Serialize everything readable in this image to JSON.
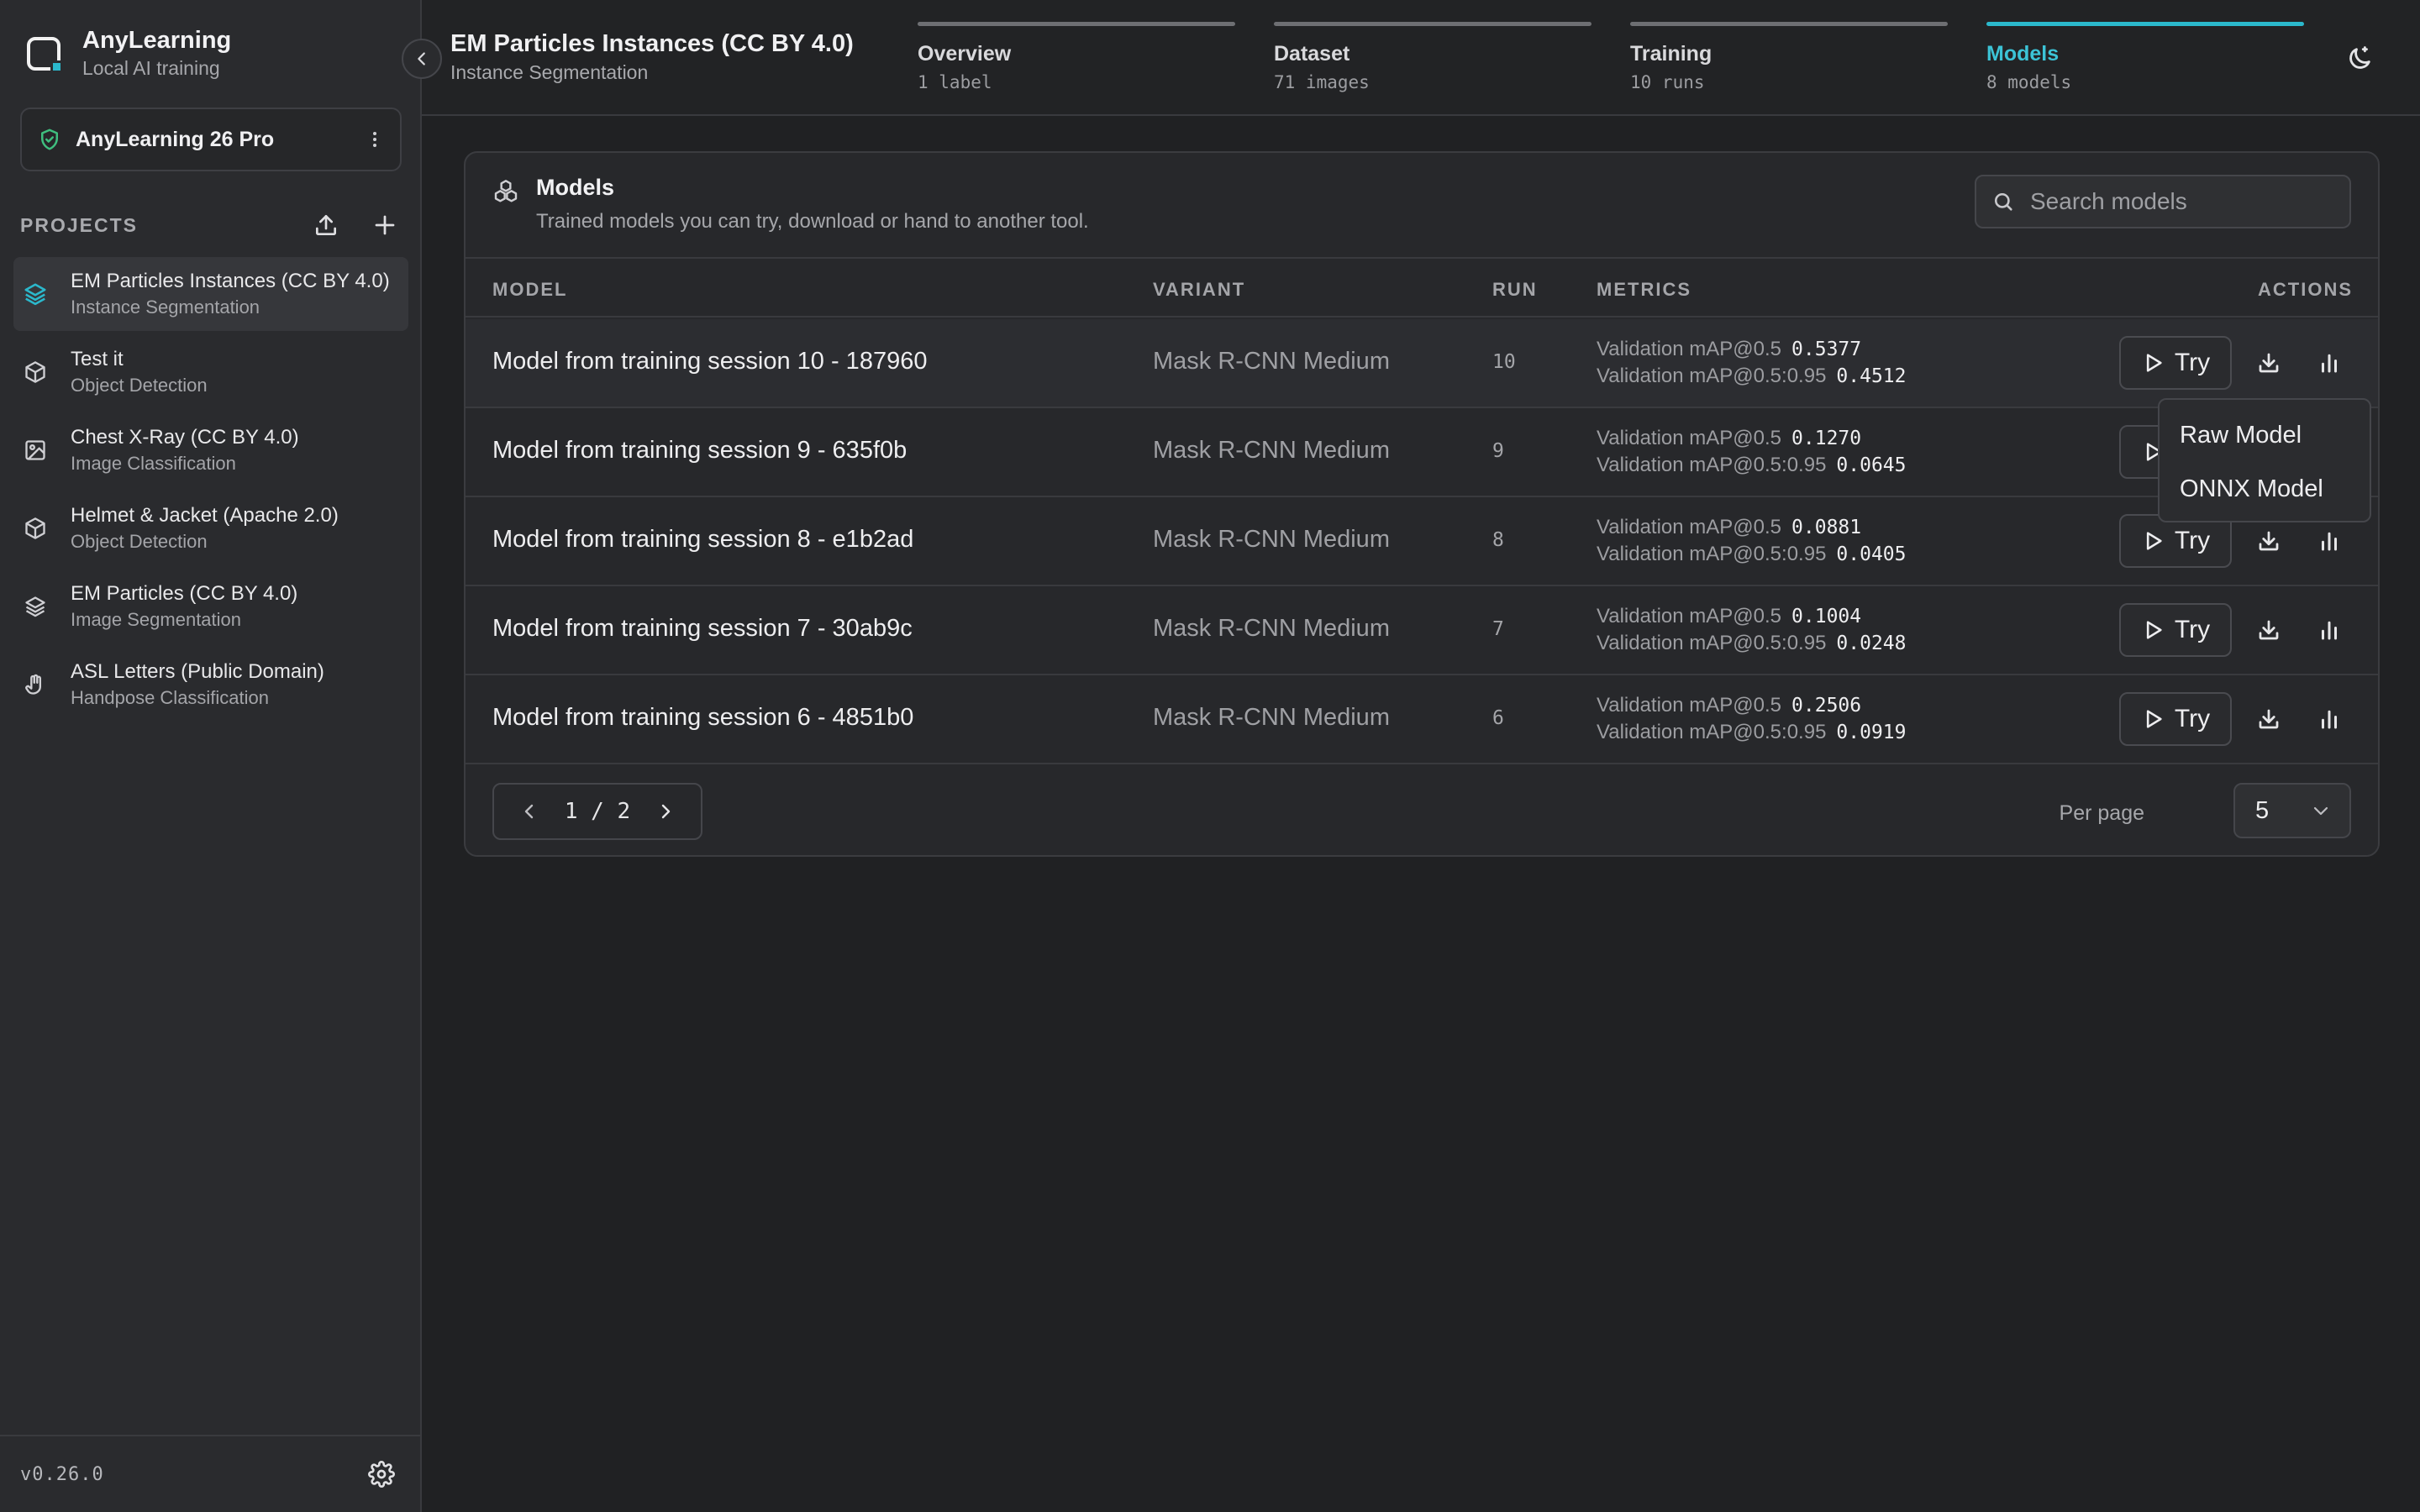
{
  "app": {
    "name": "AnyLearning",
    "subtitle": "Local AI training",
    "version": "v0.26.0"
  },
  "plan": {
    "label": "AnyLearning 26 Pro"
  },
  "projects": {
    "title": "PROJECTS",
    "items": [
      {
        "name": "EM Particles Instances (CC BY 4.0)",
        "type": "Instance Segmentation",
        "icon": "layers-icon",
        "active": true
      },
      {
        "name": "Test it",
        "type": "Object Detection",
        "icon": "cube-icon"
      },
      {
        "name": "Chest X-Ray (CC BY 4.0)",
        "type": "Image Classification",
        "icon": "image-icon"
      },
      {
        "name": "Helmet & Jacket (Apache 2.0)",
        "type": "Object Detection",
        "icon": "cube-icon"
      },
      {
        "name": "EM Particles (CC BY 4.0)",
        "type": "Image Segmentation",
        "icon": "layers-icon"
      },
      {
        "name": "ASL Letters (Public Domain)",
        "type": "Handpose Classification",
        "icon": "hand-icon"
      }
    ]
  },
  "header": {
    "project_title": "EM Particles Instances (CC BY 4.0)",
    "project_type": "Instance Segmentation",
    "tabs": [
      {
        "label": "Overview",
        "meta": "1 label"
      },
      {
        "label": "Dataset",
        "meta": "71 images"
      },
      {
        "label": "Training",
        "meta": "10 runs"
      },
      {
        "label": "Models",
        "meta": "8 models",
        "active": true
      }
    ]
  },
  "models": {
    "title": "Models",
    "subtitle": "Trained models you can try, download or hand to another tool.",
    "search_placeholder": "Search models",
    "columns": {
      "model": "MODEL",
      "variant": "VARIANT",
      "run": "RUN",
      "metrics": "METRICS",
      "actions": "ACTIONS"
    },
    "try_label": "Try",
    "rows": [
      {
        "name": "Model from training session 10 - 187960",
        "variant": "Mask R-CNN Medium",
        "run": "10",
        "m1_label": "Validation mAP@0.5",
        "m1_value": "0.5377",
        "m2_label": "Validation mAP@0.5:0.95",
        "m2_value": "0.4512"
      },
      {
        "name": "Model from training session 9 - 635f0b",
        "variant": "Mask R-CNN Medium",
        "run": "9",
        "m1_label": "Validation mAP@0.5",
        "m1_value": "0.1270",
        "m2_label": "Validation mAP@0.5:0.95",
        "m2_value": "0.0645"
      },
      {
        "name": "Model from training session 8 - e1b2ad",
        "variant": "Mask R-CNN Medium",
        "run": "8",
        "m1_label": "Validation mAP@0.5",
        "m1_value": "0.0881",
        "m2_label": "Validation mAP@0.5:0.95",
        "m2_value": "0.0405"
      },
      {
        "name": "Model from training session 7 - 30ab9c",
        "variant": "Mask R-CNN Medium",
        "run": "7",
        "m1_label": "Validation mAP@0.5",
        "m1_value": "0.1004",
        "m2_label": "Validation mAP@0.5:0.95",
        "m2_value": "0.0248"
      },
      {
        "name": "Model from training session 6 - 4851b0",
        "variant": "Mask R-CNN Medium",
        "run": "6",
        "m1_label": "Validation mAP@0.5",
        "m1_value": "0.2506",
        "m2_label": "Validation mAP@0.5:0.95",
        "m2_value": "0.0919"
      }
    ],
    "download_menu": [
      "Raw Model",
      "ONNX Model"
    ],
    "pagination": {
      "current": "1",
      "separator": "/",
      "total": "2"
    },
    "per_page_label": "Per page",
    "per_page_value": "5"
  },
  "colors": {
    "accent": "#2bb8cc",
    "background": "#202123",
    "sidebar": "#2a2b2e",
    "plan_icon": "#3fbf7f"
  }
}
